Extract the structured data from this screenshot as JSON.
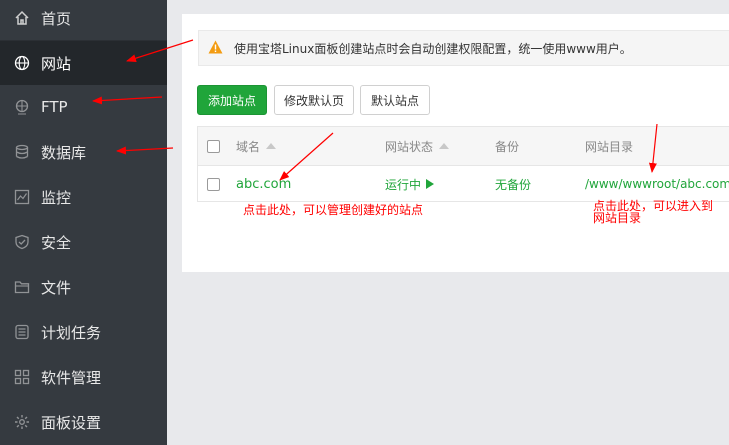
{
  "sidebar": {
    "items": [
      {
        "label": "首页",
        "icon": "home-icon"
      },
      {
        "label": "网站",
        "icon": "globe-icon"
      },
      {
        "label": "FTP",
        "icon": "ftp-icon"
      },
      {
        "label": "数据库",
        "icon": "database-icon"
      },
      {
        "label": "监控",
        "icon": "monitor-chart-icon"
      },
      {
        "label": "安全",
        "icon": "shield-icon"
      },
      {
        "label": "文件",
        "icon": "folder-icon"
      },
      {
        "label": "计划任务",
        "icon": "task-list-icon"
      },
      {
        "label": "软件管理",
        "icon": "apps-grid-icon"
      },
      {
        "label": "面板设置",
        "icon": "gear-icon"
      }
    ],
    "active_label": "网站"
  },
  "notice": {
    "text": "使用宝塔Linux面板创建站点时会自动创建权限配置，统一使用www用户。"
  },
  "toolbar": {
    "add_site": "添加站点",
    "edit_default_page": "修改默认页",
    "default_site": "默认站点"
  },
  "table": {
    "headers": {
      "domain": "域名",
      "status": "网站状态",
      "backup": "备份",
      "root": "网站目录"
    },
    "rows": [
      {
        "domain": "abc.com",
        "status": "运行中",
        "backup": "无备份",
        "root": "/www/wwwroot/abc.com"
      }
    ]
  },
  "annotations": {
    "manage_site": "点击此处，可以管理创建好的站点",
    "open_dir_line1": "点击此处，可以进入到",
    "open_dir_line2": "网站目录"
  },
  "colors": {
    "sidebar_bg": "#353a40",
    "active_bg": "#23272b",
    "accent": "#20a53a",
    "annotation": "#ff0000"
  }
}
